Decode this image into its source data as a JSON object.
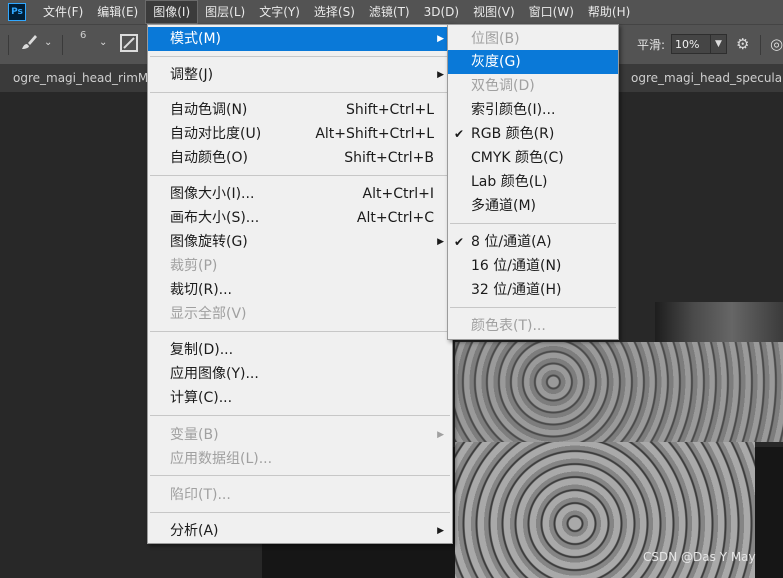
{
  "app": {
    "logo": "Ps"
  },
  "menubar": {
    "items": [
      "文件(F)",
      "编辑(E)",
      "图像(I)",
      "图层(L)",
      "文字(Y)",
      "选择(S)",
      "滤镜(T)",
      "3D(D)",
      "视图(V)",
      "窗口(W)",
      "帮助(H)"
    ]
  },
  "options": {
    "brush_size": "6",
    "smoothing_label": "平滑:",
    "smoothing_value": "10%"
  },
  "tabs": [
    "ogre_magi_head_rimMask",
    "ogre_magi_head_specularMa"
  ],
  "image_menu": {
    "mode": "模式(M)",
    "adjust": "调整(J)",
    "auto_tone": "自动色调(N)",
    "auto_tone_sc": "Shift+Ctrl+L",
    "auto_contrast": "自动对比度(U)",
    "auto_contrast_sc": "Alt+Shift+Ctrl+L",
    "auto_color": "自动颜色(O)",
    "auto_color_sc": "Shift+Ctrl+B",
    "image_size": "图像大小(I)...",
    "image_size_sc": "Alt+Ctrl+I",
    "canvas_size": "画布大小(S)...",
    "canvas_size_sc": "Alt+Ctrl+C",
    "rotation": "图像旋转(G)",
    "crop": "裁剪(P)",
    "trim": "裁切(R)...",
    "reveal_all": "显示全部(V)",
    "duplicate": "复制(D)...",
    "apply_image": "应用图像(Y)...",
    "calculations": "计算(C)...",
    "variables": "变量(B)",
    "apply_data_set": "应用数据组(L)...",
    "trap": "陷印(T)...",
    "analysis": "分析(A)"
  },
  "mode_menu": {
    "bitmap": "位图(B)",
    "grayscale": "灰度(G)",
    "duotone": "双色调(D)",
    "indexed": "索引颜色(I)...",
    "rgb": "RGB 颜色(R)",
    "cmyk": "CMYK 颜色(C)",
    "lab": "Lab 颜色(L)",
    "multichannel": "多通道(M)",
    "bits8": "8 位/通道(A)",
    "bits16": "16 位/通道(N)",
    "bits32": "32 位/通道(H)",
    "color_table": "颜色表(T)..."
  },
  "watermark": "CSDN @Das Y May",
  "colors": {
    "highlight": "#0a79d8",
    "menu_bg": "#f0f0f0",
    "app_bg": "#535353"
  }
}
